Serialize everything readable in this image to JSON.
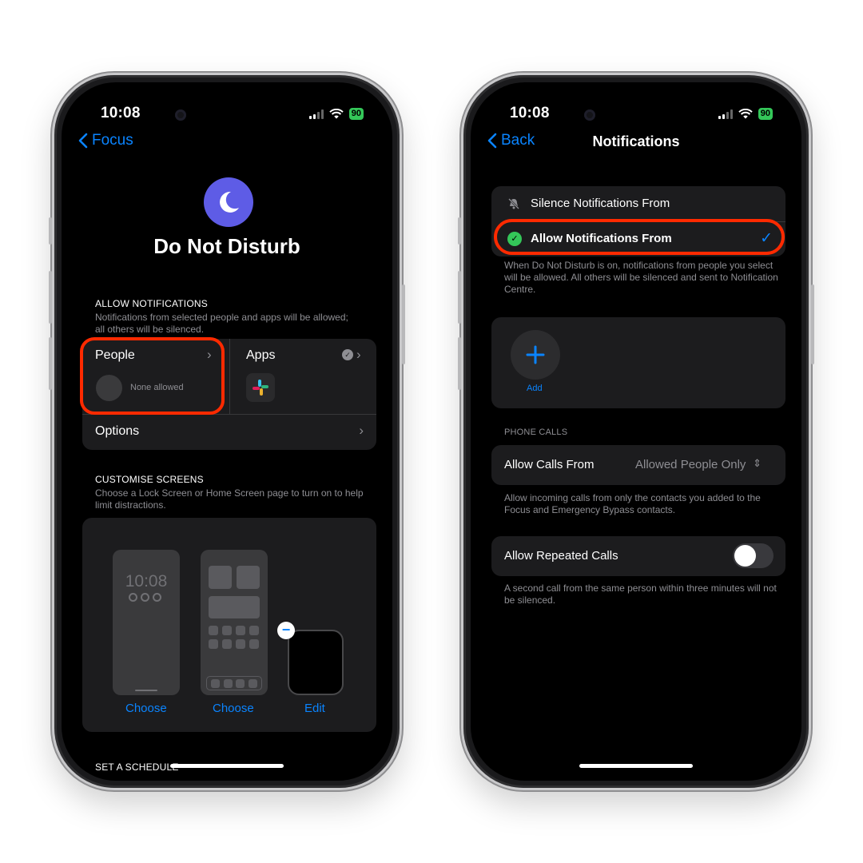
{
  "status": {
    "time": "10:08",
    "battery": "90"
  },
  "left": {
    "back_label": "Focus",
    "title": "Do Not Disturb",
    "allow_header": "ALLOW NOTIFICATIONS",
    "allow_sub": "Notifications from selected people and apps will be allowed; all others will be silenced.",
    "people_label": "People",
    "people_value": "None allowed",
    "apps_label": "Apps",
    "options_label": "Options",
    "customise_header": "CUSTOMISE SCREENS",
    "customise_sub": "Choose a Lock Screen or Home Screen page to turn on to help limit distractions.",
    "lock_time": "10:08",
    "choose_lock": "Choose",
    "choose_home": "Choose",
    "edit_label": "Edit",
    "schedule_header": "SET A SCHEDULE"
  },
  "right": {
    "back_label": "Back",
    "title": "Notifications",
    "silence_label": "Silence Notifications From",
    "allow_label": "Allow Notifications From",
    "allow_desc": "When Do Not Disturb is on, notifications from people you select will be allowed. All others will be silenced and sent to Notification Centre.",
    "add_label": "Add",
    "phone_calls_header": "PHONE CALLS",
    "allow_calls_label": "Allow Calls From",
    "allow_calls_value": "Allowed People Only",
    "allow_calls_desc": "Allow incoming calls from only the contacts you added to the Focus and Emergency Bypass contacts.",
    "repeated_label": "Allow Repeated Calls",
    "repeated_on": false,
    "repeated_desc": "A second call from the same person within three minutes will not be silenced."
  },
  "colors": {
    "accent": "#0a84ff",
    "focus_purple": "#5e5ce6",
    "highlight": "#ff2a00",
    "battery": "#34c759"
  }
}
